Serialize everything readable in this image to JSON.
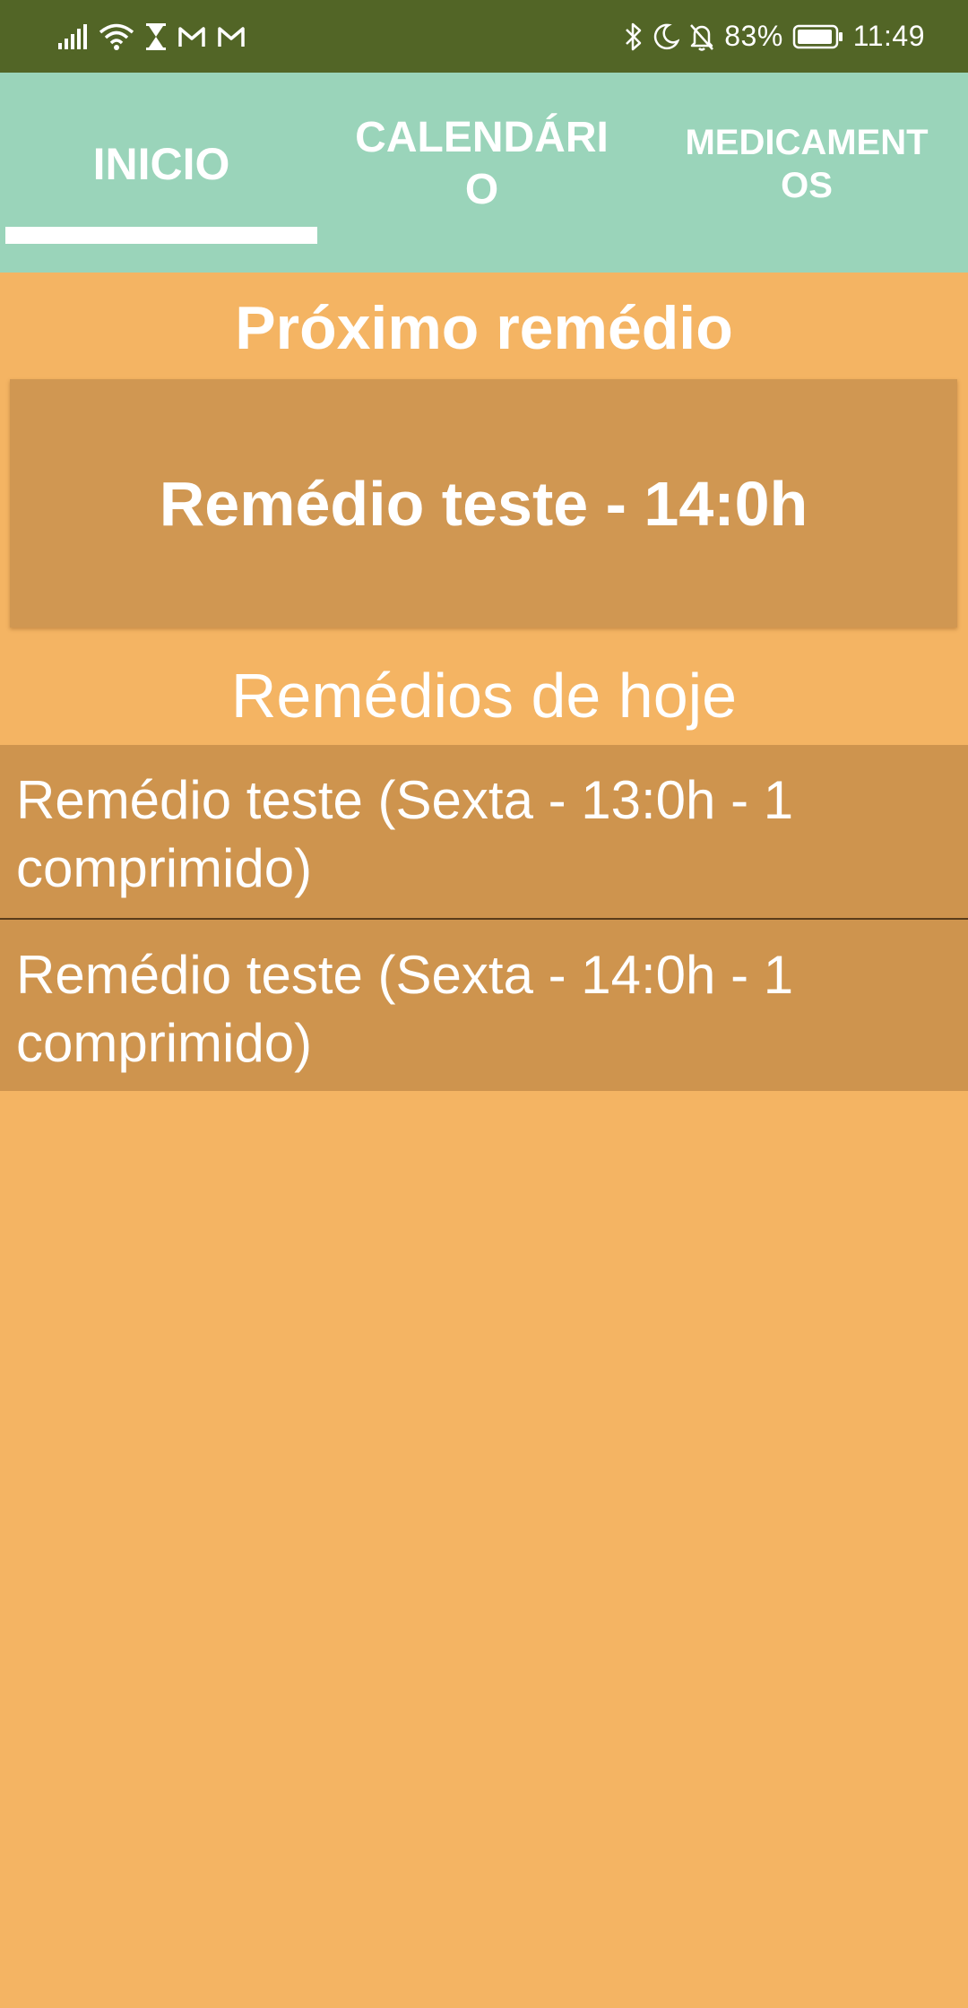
{
  "status_bar": {
    "battery_percent": "83%",
    "time": "11:49",
    "left_icons": [
      "signal-icon",
      "wifi-icon",
      "hourglass-icon",
      "gmail-icon",
      "gmail-icon"
    ],
    "right_icons": [
      "bluetooth-icon",
      "moon-icon",
      "bell-off-icon",
      "battery-icon"
    ]
  },
  "tabs": [
    {
      "label": "INICIO",
      "selected": true
    },
    {
      "label": "CALENDÁRIO",
      "selected": false
    },
    {
      "label": "MEDICAMENTOS",
      "selected": false
    }
  ],
  "next_medicine": {
    "heading": "Próximo remédio",
    "value": "Remédio teste - 14:0h"
  },
  "today": {
    "heading": "Remédios de hoje",
    "items": [
      {
        "text": "Remédio teste (Sexta - 13:0h - 1 comprimido)"
      },
      {
        "text": "Remédio teste (Sexta - 14:0h - 1 comprimido)"
      }
    ]
  },
  "colors": {
    "status_bar": "#526526",
    "tab_bar": "#9AD4BA",
    "background": "#F4B463",
    "card": "#D09752",
    "list_item": "#CE944E"
  }
}
